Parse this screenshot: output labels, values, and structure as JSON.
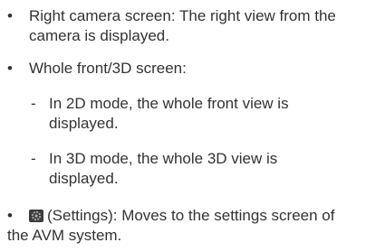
{
  "bullets": {
    "right_camera": {
      "text": "Right camera screen: The right view from the camera is displayed."
    },
    "whole_front": {
      "text": "Whole front/3D screen:",
      "sub": [
        "In 2D mode, the whole front view is displayed.",
        "In 3D mode, the whole 3D view is displayed."
      ]
    },
    "settings": {
      "label": "(Settings): Moves to the settings screen of",
      "continuation": "the AVM system.",
      "icon": "settings-gear-icon"
    }
  },
  "symbols": {
    "bullet": "•",
    "dash": "-"
  }
}
